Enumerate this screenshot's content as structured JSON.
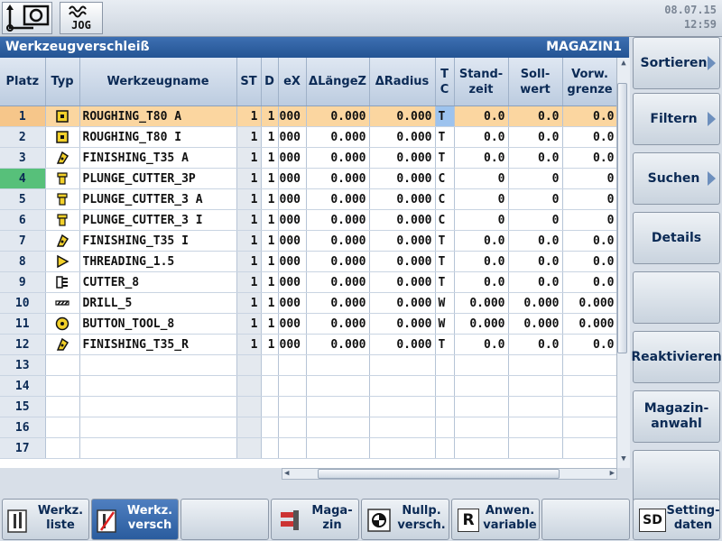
{
  "topbar": {
    "datetime": {
      "date": "08.07.15",
      "time": "12:59"
    },
    "jog_label": "JOG"
  },
  "window": {
    "title": "Werkzeugverschleiß",
    "magazine": "MAGAZIN1"
  },
  "table": {
    "headers": [
      "Platz",
      "Typ",
      "Werkzeugname",
      "ST",
      "D",
      "eX",
      "ΔLängeZ",
      "ΔRadius",
      "T C",
      "Stand- zeit",
      "Soll- wert",
      "Vorw. grenze"
    ],
    "rows": [
      {
        "platz": "1",
        "name": "ROUGHING_T80 A",
        "st": "1",
        "d": "1",
        "ex": "000",
        "dl": "0.000",
        "dr": "0.000",
        "tc": "T",
        "sz": "0.0",
        "sw": "0.0",
        "vg": "0.0",
        "icon": "roughing-tool-icon"
      },
      {
        "platz": "2",
        "name": "ROUGHING_T80 I",
        "st": "1",
        "d": "1",
        "ex": "000",
        "dl": "0.000",
        "dr": "0.000",
        "tc": "T",
        "sz": "0.0",
        "sw": "0.0",
        "vg": "0.0",
        "icon": "roughing-tool-icon"
      },
      {
        "platz": "3",
        "name": "FINISHING_T35 A",
        "st": "1",
        "d": "1",
        "ex": "000",
        "dl": "0.000",
        "dr": "0.000",
        "tc": "T",
        "sz": "0.0",
        "sw": "0.0",
        "vg": "0.0",
        "icon": "finishing-tool-icon"
      },
      {
        "platz": "4",
        "name": "PLUNGE_CUTTER_3P",
        "st": "1",
        "d": "1",
        "ex": "000",
        "dl": "0.000",
        "dr": "0.000",
        "tc": "C",
        "sz": "0",
        "sw": "0",
        "vg": "0",
        "icon": "plunge-cutter-icon"
      },
      {
        "platz": "5",
        "name": "PLUNGE_CUTTER_3 A",
        "st": "1",
        "d": "1",
        "ex": "000",
        "dl": "0.000",
        "dr": "0.000",
        "tc": "C",
        "sz": "0",
        "sw": "0",
        "vg": "0",
        "icon": "plunge-cutter-icon"
      },
      {
        "platz": "6",
        "name": "PLUNGE_CUTTER_3 I",
        "st": "1",
        "d": "1",
        "ex": "000",
        "dl": "0.000",
        "dr": "0.000",
        "tc": "C",
        "sz": "0",
        "sw": "0",
        "vg": "0",
        "icon": "plunge-cutter-icon"
      },
      {
        "platz": "7",
        "name": "FINISHING_T35 I",
        "st": "1",
        "d": "1",
        "ex": "000",
        "dl": "0.000",
        "dr": "0.000",
        "tc": "T",
        "sz": "0.0",
        "sw": "0.0",
        "vg": "0.0",
        "icon": "finishing-tool-icon"
      },
      {
        "platz": "8",
        "name": "THREADING_1.5",
        "st": "1",
        "d": "1",
        "ex": "000",
        "dl": "0.000",
        "dr": "0.000",
        "tc": "T",
        "sz": "0.0",
        "sw": "0.0",
        "vg": "0.0",
        "icon": "threading-tool-icon"
      },
      {
        "platz": "9",
        "name": "CUTTER_8",
        "st": "1",
        "d": "1",
        "ex": "000",
        "dl": "0.000",
        "dr": "0.000",
        "tc": "T",
        "sz": "0.0",
        "sw": "0.0",
        "vg": "0.0",
        "icon": "cutter-icon"
      },
      {
        "platz": "10",
        "name": "DRILL_5",
        "st": "1",
        "d": "1",
        "ex": "000",
        "dl": "0.000",
        "dr": "0.000",
        "tc": "W",
        "sz": "0.000",
        "sw": "0.000",
        "vg": "0.000",
        "icon": "drill-icon"
      },
      {
        "platz": "11",
        "name": "BUTTON_TOOL_8",
        "st": "1",
        "d": "1",
        "ex": "000",
        "dl": "0.000",
        "dr": "0.000",
        "tc": "W",
        "sz": "0.000",
        "sw": "0.000",
        "vg": "0.000",
        "icon": "button-tool-icon"
      },
      {
        "platz": "12",
        "name": "FINISHING_T35_R",
        "st": "1",
        "d": "1",
        "ex": "000",
        "dl": "0.000",
        "dr": "0.000",
        "tc": "T",
        "sz": "0.0",
        "sw": "0.0",
        "vg": "0.0",
        "icon": "finishing-tool-icon"
      },
      {
        "platz": "13"
      },
      {
        "platz": "14"
      },
      {
        "platz": "15"
      },
      {
        "platz": "16"
      },
      {
        "platz": "17"
      }
    ]
  },
  "right_softkeys": {
    "sortieren": "Sortieren",
    "filtern": "Filtern",
    "suchen": "Suchen",
    "details": "Details",
    "reaktivieren": "Reaktivieren",
    "magazinanwahl_1": "Magazin-",
    "magazinanwahl_2": "anwahl"
  },
  "bottom_softkeys": {
    "werkzliste_1": "Werkz.",
    "werkzliste_2": "liste",
    "werkzversch_1": "Werkz.",
    "werkzversch_2": "versch",
    "magazin_1": "Maga-",
    "magazin_2": "zin",
    "nullp_1": "Nullp.",
    "nullp_2": "versch.",
    "anwen_1": "Anwen.",
    "anwen_2": "variable",
    "anwen_glyph": "R",
    "setting_1": "Setting-",
    "setting_2": "daten",
    "setting_glyph": "SD"
  },
  "colors": {
    "title_bar": "#2f62a6",
    "selected_row": "#fbd6a0",
    "green_marker": "#57c07a",
    "text_dark": "#0b2a55"
  }
}
